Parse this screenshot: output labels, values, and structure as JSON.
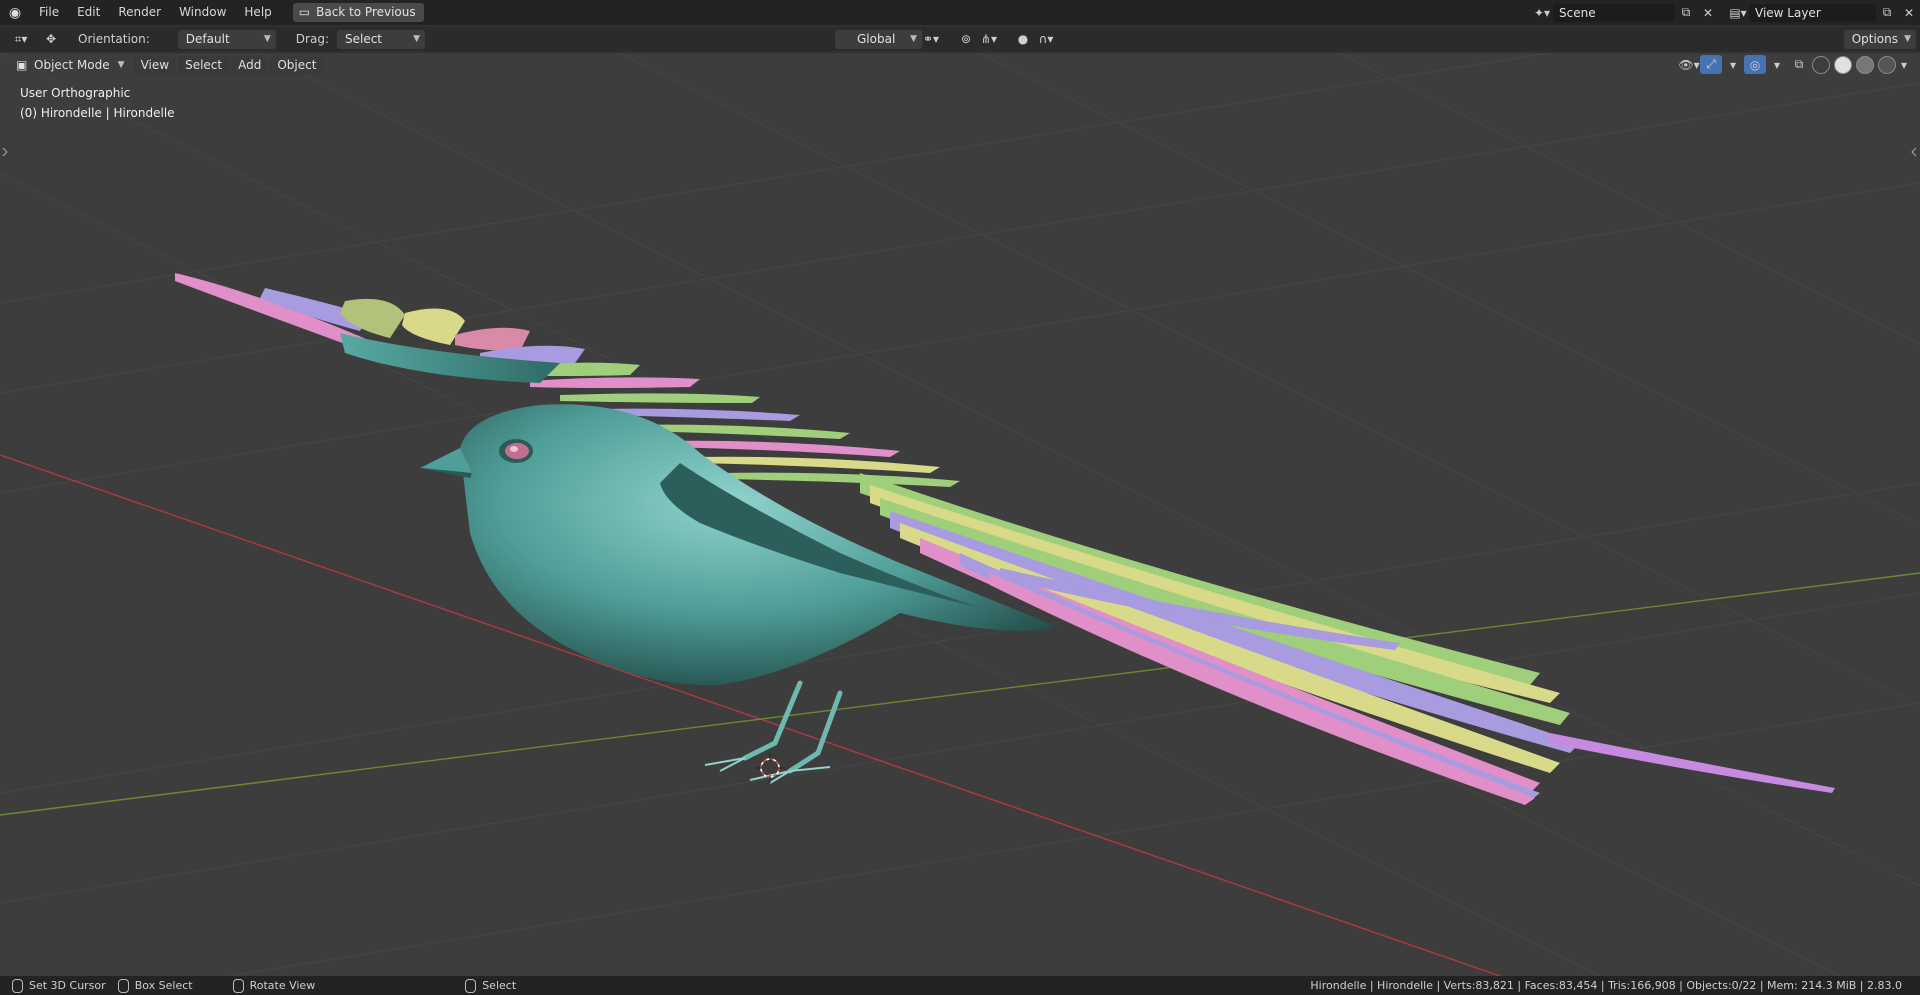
{
  "menu": {
    "items": [
      "File",
      "Edit",
      "Render",
      "Window",
      "Help"
    ],
    "back_button": "Back to Previous"
  },
  "workspace": {
    "scene": "Scene",
    "view_layer": "View Layer"
  },
  "toolbar": {
    "orientation_label": "Orientation:",
    "orientation_value": "Default",
    "drag_label": "Drag:",
    "drag_value": "Select Box",
    "transform_orientation": "Global",
    "options": "Options"
  },
  "header": {
    "mode": "Object Mode",
    "view": "View",
    "select": "Select",
    "add": "Add",
    "object": "Object"
  },
  "viewport": {
    "projection": "User Orthographic",
    "active_object": "(0) Hirondelle | Hirondelle"
  },
  "status": {
    "lmb": "Set 3D Cursor",
    "drag": "Box Select",
    "mmb": "Rotate View",
    "rmb": "Select",
    "stats": "Hirondelle | Hirondelle | Verts:83,821 | Faces:83,454 | Tris:166,908 | Objects:0/22 | Mem: 214.3 MiB | 2.83.0"
  },
  "colors": {
    "body": "#6fb8b2",
    "feather_pink": "#e08fc9",
    "feather_green": "#9fcf7a",
    "feather_yellow": "#d9d98a",
    "feather_purple": "#a89be0",
    "axis_x": "#b0393f",
    "axis_y": "#6a8a33"
  }
}
